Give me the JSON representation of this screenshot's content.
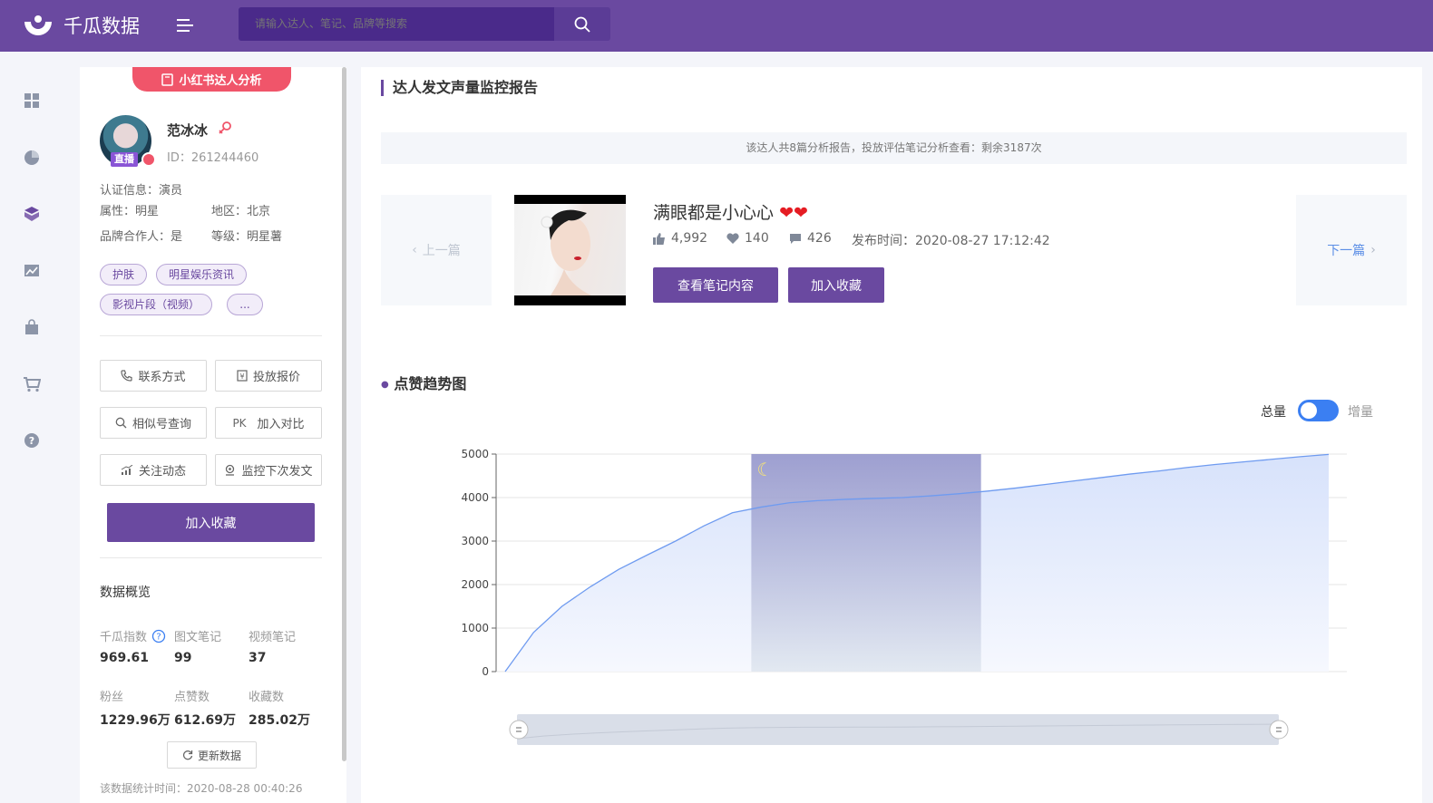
{
  "app": {
    "logo_text": "千瓜数据",
    "search_placeholder": "请输入达人、笔记、品牌等搜索"
  },
  "sidebar_nav": [
    "dashboard-icon",
    "pie-chart-icon",
    "cube-icon",
    "image-chart-icon",
    "shopping-bag-icon",
    "cart-icon",
    "help-icon"
  ],
  "profile": {
    "badge": "小红书达人分析",
    "live_tag": "直播",
    "name": "范冰冰",
    "id": "ID：261244460",
    "cert": "认证信息：演员",
    "attr": "属性：明星",
    "region": "地区：北京",
    "brand_partner": "品牌合作人：是",
    "level": "等级：明星薯",
    "tags": [
      "护肤",
      "明星娱乐资讯",
      "影视片段（视频）",
      "..."
    ],
    "actions": {
      "contact": "联系方式",
      "quote": "投放报价",
      "similar": "相似号查询",
      "compare": "加入对比",
      "compare_prefix": "PK",
      "follow": "关注动态",
      "monitor": "监控下次发文"
    },
    "favorite": "加入收藏",
    "overview_title": "数据概览",
    "stats": [
      {
        "label": "千瓜指数",
        "value": "969.61"
      },
      {
        "label": "图文笔记",
        "value": "99"
      },
      {
        "label": "视频笔记",
        "value": "37"
      },
      {
        "label": "粉丝",
        "value": "1229.96万"
      },
      {
        "label": "点赞数",
        "value": "612.69万"
      },
      {
        "label": "收藏数",
        "value": "285.02万"
      }
    ],
    "refresh": "更新数据",
    "stat_time": "该数据统计时间：2020-08-28 00:40:26"
  },
  "report": {
    "title": "达人发文声量监控报告",
    "notice": "该达人共8篇分析报告，投放评估笔记分析查看：剩余3187次",
    "prev": "上一篇",
    "next": "下一篇",
    "note_title": "满眼都是小心心",
    "likes": "4,992",
    "collects": "140",
    "comments": "426",
    "publish_time": "发布时间：2020-08-27 17:12:42",
    "view_btn": "查看笔记内容",
    "fav_btn": "加入收藏",
    "chart_section": "点赞趋势图",
    "toggle_total": "总量",
    "toggle_incr": "增量"
  },
  "colors": {
    "brand": "#6a49a0",
    "line": "#6f9bf0",
    "toggle": "#3b7ff2"
  },
  "chart_data": {
    "type": "area",
    "title": "",
    "xlabel": "",
    "ylabel": "",
    "ylim": [
      0,
      5000
    ],
    "yticks": [
      0,
      1000,
      2000,
      3000,
      4000,
      5000
    ],
    "grid": true,
    "night_band": [
      0.3,
      0.57
    ],
    "series": [
      {
        "values": [
          0,
          900,
          1500,
          1950,
          2350,
          2680,
          3000,
          3350,
          3650,
          3780,
          3880,
          3930,
          3960,
          3980,
          4000,
          4040,
          4090,
          4150,
          4220,
          4300,
          4380,
          4460,
          4540,
          4610,
          4690,
          4760,
          4820,
          4880,
          4940,
          4992
        ]
      }
    ]
  }
}
